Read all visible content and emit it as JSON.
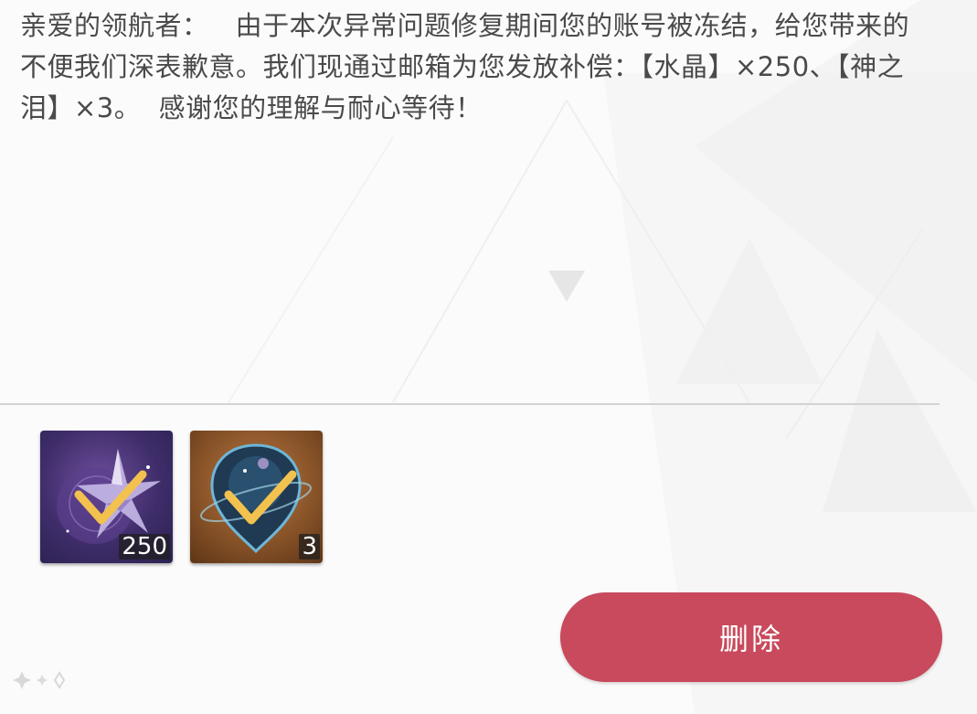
{
  "mail": {
    "body": "亲爱的领航者：   由于本次异常问题修复期间您的账号被冻结，给您带来的不便我们深表歉意。我们现通过邮箱为您发放补偿：【水晶】×250、【神之泪】×3。  感谢您的理解与耐心等待！"
  },
  "rewards": [
    {
      "name": "crystal-reward-icon",
      "quantity": "250",
      "claimed": true
    },
    {
      "name": "tear-of-god-reward-icon",
      "quantity": "3",
      "claimed": true
    }
  ],
  "actions": {
    "delete_label": "删除"
  },
  "colors": {
    "delete_button": "#c84a5c",
    "body_text": "#4a4a4a",
    "check_mark": "#f2c14e"
  }
}
